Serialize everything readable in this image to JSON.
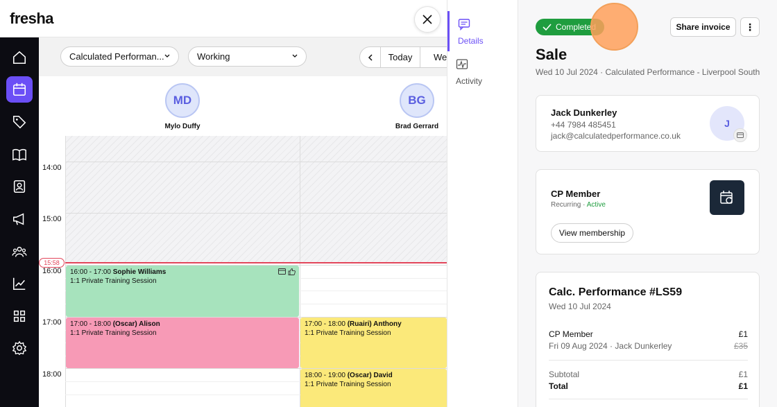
{
  "app": {
    "logo": "fresha"
  },
  "filters": {
    "location": "Calculated Performan...",
    "team": "Working",
    "today_label": "Today",
    "view_label": "Wee"
  },
  "staff": [
    {
      "initials": "MD",
      "name": "Mylo Duffy"
    },
    {
      "initials": "BG",
      "name": "Brad Gerrard"
    }
  ],
  "times": [
    "14:00",
    "15:00",
    "16:00",
    "17:00",
    "18:00"
  ],
  "now_time": "15:58",
  "appointments": [
    {
      "time": "16:00 - 17:00",
      "client": "Sophie Williams",
      "service": "1:1 Private Training Session",
      "color": "#a7e3bd"
    },
    {
      "time": "17:00 - 18:00",
      "client": "(Oscar) Alison",
      "service": "1:1 Private Training Session",
      "color": "#f79ab6"
    },
    {
      "time": "17:00 - 18:00",
      "client": "(Ruairi) Anthony",
      "service": "1:1 Private Training Session",
      "color": "#fbe97a"
    },
    {
      "time": "18:00 - 19:00",
      "client": "(Oscar) David",
      "service": "1:1 Private Training Session",
      "color": "#fbe97a"
    }
  ],
  "side_tabs": {
    "details": "Details",
    "activity": "Activity"
  },
  "sale": {
    "status": "Completed",
    "share_label": "Share invoice",
    "more_label": "⋮",
    "title": "Sale",
    "subtitle": "Wed 10 Jul 2024 · Calculated Performance - Liverpool South"
  },
  "client": {
    "name": "Jack Dunkerley",
    "phone": "+44 7984 485451",
    "email": "jack@calculatedperformance.co.uk",
    "initial": "J"
  },
  "membership": {
    "name": "CP Member",
    "type": "Recurring",
    "status": "Active",
    "button": "View membership"
  },
  "invoice": {
    "title": "Calc. Performance #LS59",
    "date": "Wed 10 Jul 2024",
    "item_name": "CP Member",
    "item_price": "£1",
    "item_sub": "Fri 09 Aug 2024 · Jack Dunkerley",
    "item_orig_price": "£35",
    "subtotal_label": "Subtotal",
    "subtotal": "£1",
    "total_label": "Total",
    "total": "£1"
  },
  "colors": {
    "accent": "#6b4ff6",
    "success": "#1f9d3f",
    "now": "#e2455a"
  }
}
